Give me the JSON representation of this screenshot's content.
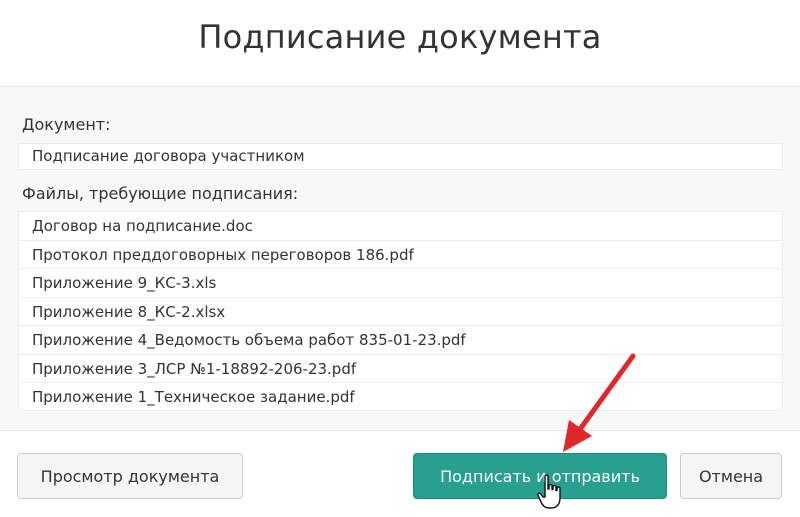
{
  "dialog": {
    "title": "Подписание документа"
  },
  "document": {
    "label": "Документ:",
    "value": "Подписание договора участником"
  },
  "files": {
    "label": "Файлы, требующие подписания:",
    "items": [
      "Договор на подписание.doc",
      "Протокол преддоговорных переговоров 186.pdf",
      "Приложение 9_КС-3.xls",
      "Приложение 8_КС-2.xlsx",
      "Приложение 4_Ведомость объема работ 835-01-23.pdf",
      "Приложение 3_ЛСР №1-18892-206-23.pdf",
      "Приложение 1_Техническое задание.pdf"
    ]
  },
  "footer": {
    "preview_label": "Просмотр документа",
    "sign_label": "Подписать и отправить",
    "cancel_label": "Отмена"
  },
  "colors": {
    "accent": "#27a08f",
    "annotation": "#e0282a"
  },
  "icons": {
    "arrow": "red-arrow-icon",
    "cursor": "hand-pointer-icon"
  }
}
